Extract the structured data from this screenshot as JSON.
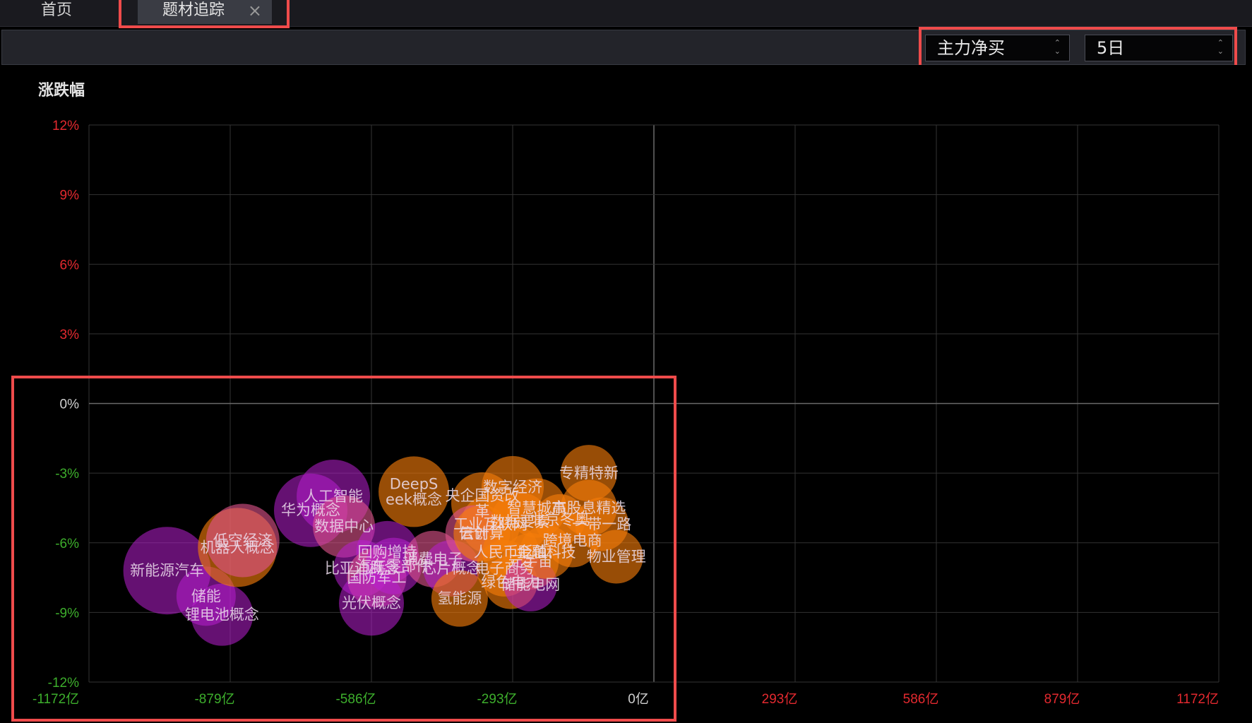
{
  "tabs": {
    "home": "首页",
    "active": "题材追踪",
    "close": "×"
  },
  "toolbar": {
    "metric_value": "主力净买",
    "period_value": "5日"
  },
  "colors": {
    "positive_axis": "#e3292f",
    "negative_axis": "#3dae2c",
    "zero_axis": "#cfcfcf",
    "grid": "#333333",
    "bubble_orange": "#f57d0a",
    "bubble_purple": "#c41cd6",
    "highlight": "#ef4b4b"
  },
  "chart_data": {
    "type": "scatter",
    "title": "涨跌幅",
    "xlabel": "",
    "ylabel": "涨跌幅",
    "xlim": [
      -1172,
      1172
    ],
    "ylim": [
      -12,
      12
    ],
    "grid": true,
    "x_ticks": [
      {
        "value": -1172,
        "label": "-1172亿",
        "sign": "neg"
      },
      {
        "value": -879,
        "label": "-879亿",
        "sign": "neg"
      },
      {
        "value": -586,
        "label": "-586亿",
        "sign": "neg"
      },
      {
        "value": -293,
        "label": "-293亿",
        "sign": "neg"
      },
      {
        "value": 0,
        "label": "0亿",
        "sign": "zero"
      },
      {
        "value": 293,
        "label": "293亿",
        "sign": "pos"
      },
      {
        "value": 586,
        "label": "586亿",
        "sign": "pos"
      },
      {
        "value": 879,
        "label": "879亿",
        "sign": "pos"
      },
      {
        "value": 1172,
        "label": "1172亿",
        "sign": "pos"
      }
    ],
    "y_ticks": [
      {
        "value": 12,
        "label": "12%",
        "sign": "pos"
      },
      {
        "value": 9,
        "label": "9%",
        "sign": "pos"
      },
      {
        "value": 6,
        "label": "6%",
        "sign": "pos"
      },
      {
        "value": 3,
        "label": "3%",
        "sign": "pos"
      },
      {
        "value": 0,
        "label": "0%",
        "sign": "zero"
      },
      {
        "value": -3,
        "label": "-3%",
        "sign": "neg"
      },
      {
        "value": -6,
        "label": "-6%",
        "sign": "neg"
      },
      {
        "value": -9,
        "label": "-9%",
        "sign": "neg"
      },
      {
        "value": -12,
        "label": "-12%",
        "sign": "neg"
      }
    ],
    "points": [
      {
        "name": "新能源汽车",
        "x": -1010,
        "y": -7.2,
        "r": 62,
        "hue": "purple"
      },
      {
        "name": "储能",
        "x": -929,
        "y": -8.3,
        "r": 42,
        "hue": "purple"
      },
      {
        "name": "锂电池概念",
        "x": -896,
        "y": -9.1,
        "r": 44,
        "hue": "purple"
      },
      {
        "name": "机器人概念",
        "x": -864,
        "y": -6.2,
        "r": 56,
        "hue": "orange"
      },
      {
        "name": "低空经济",
        "x": -853,
        "y": -5.9,
        "r": 52,
        "hue": "pink"
      },
      {
        "name": "华为概念",
        "x": -712,
        "y": -4.6,
        "r": 52,
        "hue": "purple"
      },
      {
        "name": "人工智能",
        "x": -665,
        "y": -4.0,
        "r": 52,
        "hue": "purple"
      },
      {
        "name": "数据中心",
        "x": -643,
        "y": -5.3,
        "r": 44,
        "hue": "pink"
      },
      {
        "name": "DeepSeek概念",
        "x": -498,
        "y": -3.8,
        "r": 50,
        "hue": "orange"
      },
      {
        "name": "回购增持",
        "x": -553,
        "y": -6.4,
        "r": 44,
        "hue": "purple"
      },
      {
        "name": "比亚迪概念",
        "x": -606,
        "y": -7.1,
        "r": 40,
        "hue": "purple"
      },
      {
        "name": "国防军工",
        "x": -575,
        "y": -7.5,
        "r": 42,
        "hue": "pink"
      },
      {
        "name": "光伏概念",
        "x": -586,
        "y": -8.6,
        "r": 46,
        "hue": "purple"
      },
      {
        "name": "汽车零部件",
        "x": -540,
        "y": -7.0,
        "r": 40,
        "hue": "purple"
      },
      {
        "name": "消费电子",
        "x": -458,
        "y": -6.7,
        "r": 40,
        "hue": "pink"
      },
      {
        "name": "芯片概念",
        "x": -420,
        "y": -7.1,
        "r": 40,
        "hue": "purple"
      },
      {
        "name": "氢能源",
        "x": -403,
        "y": -8.4,
        "r": 40,
        "hue": "orange"
      },
      {
        "name": "央企国资改革",
        "x": -356,
        "y": -4.3,
        "r": 44,
        "hue": "orange"
      },
      {
        "name": "数字经济",
        "x": -293,
        "y": -3.6,
        "r": 44,
        "hue": "orange"
      },
      {
        "name": "工业互联网",
        "x": -339,
        "y": -5.2,
        "r": 42,
        "hue": "orange"
      },
      {
        "name": "信创",
        "x": -374,
        "y": -5.6,
        "r": 40,
        "hue": "pink"
      },
      {
        "name": "云计算",
        "x": -357,
        "y": -5.6,
        "r": 40,
        "hue": "orange"
      },
      {
        "name": "智慧城市",
        "x": -243,
        "y": -4.5,
        "r": 42,
        "hue": "orange"
      },
      {
        "name": "数据要素",
        "x": -278,
        "y": -5.1,
        "r": 42,
        "hue": "orange"
      },
      {
        "name": "人民币贬值",
        "x": -297,
        "y": -6.4,
        "r": 40,
        "hue": "orange"
      },
      {
        "name": "元宇宙",
        "x": -256,
        "y": -6.8,
        "r": 40,
        "hue": "orange"
      },
      {
        "name": "电子商务",
        "x": -310,
        "y": -7.1,
        "r": 40,
        "hue": "orange"
      },
      {
        "name": "绿色电力",
        "x": -297,
        "y": -7.7,
        "r": 38,
        "hue": "orange"
      },
      {
        "name": "储能电网",
        "x": -256,
        "y": -7.8,
        "r": 38,
        "hue": "purple"
      },
      {
        "name": "金融科技",
        "x": -223,
        "y": -6.4,
        "r": 38,
        "hue": "orange"
      },
      {
        "name": "专精特新",
        "x": -135,
        "y": -3.0,
        "r": 40,
        "hue": "orange"
      },
      {
        "name": "高股息精选",
        "x": -135,
        "y": -4.5,
        "r": 40,
        "hue": "orange"
      },
      {
        "name": "北京冬奥",
        "x": -195,
        "y": -5.0,
        "r": 36,
        "hue": "orange"
      },
      {
        "name": "跨境电商",
        "x": -169,
        "y": -5.9,
        "r": 38,
        "hue": "orange"
      },
      {
        "name": "一带一路",
        "x": -108,
        "y": -5.2,
        "r": 38,
        "hue": "orange"
      },
      {
        "name": "物业管理",
        "x": -78,
        "y": -6.6,
        "r": 38,
        "hue": "orange"
      }
    ]
  }
}
